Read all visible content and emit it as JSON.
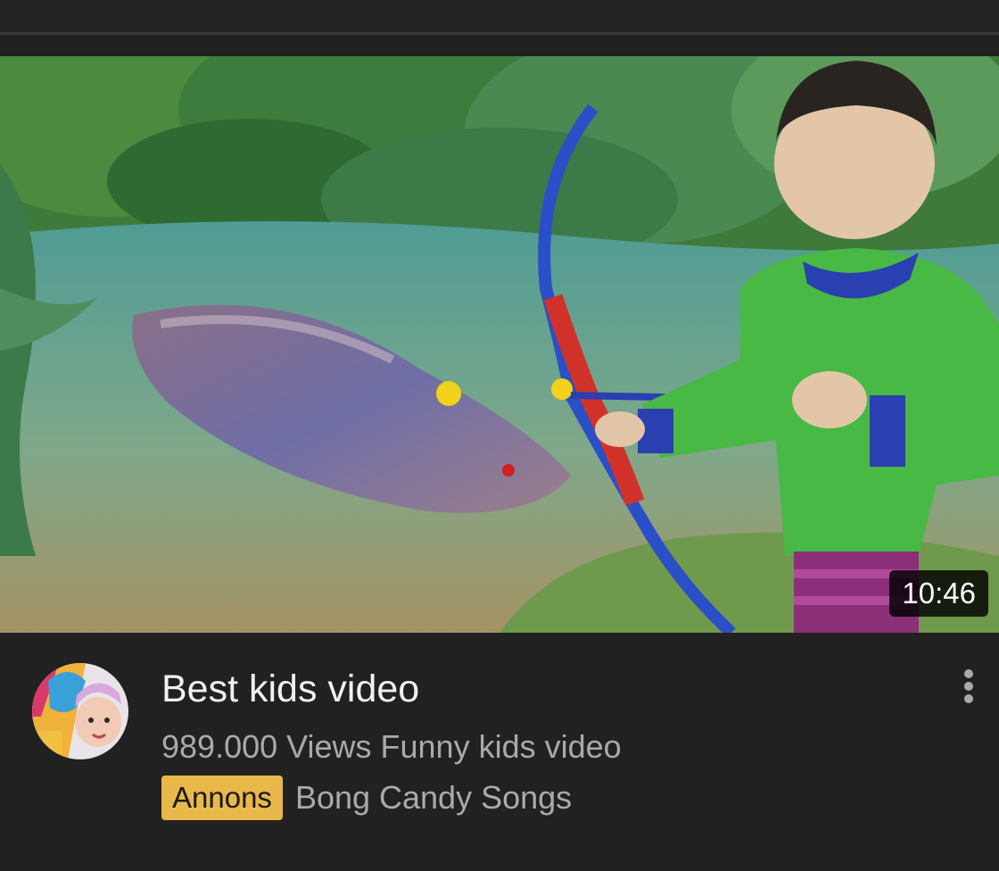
{
  "video": {
    "duration": "10:46",
    "title": "Best kids video",
    "meta": "989.000 Views Funny kids video",
    "ad_badge": "Annons",
    "advertiser": "Bong Candy Songs"
  },
  "icons": {
    "menu": "more-vert-icon",
    "avatar": "channel-avatar"
  },
  "colors": {
    "background": "#212121",
    "title": "#f1f1f1",
    "secondary_text": "#aaaaaa",
    "ad_badge": "#e8b84a"
  }
}
